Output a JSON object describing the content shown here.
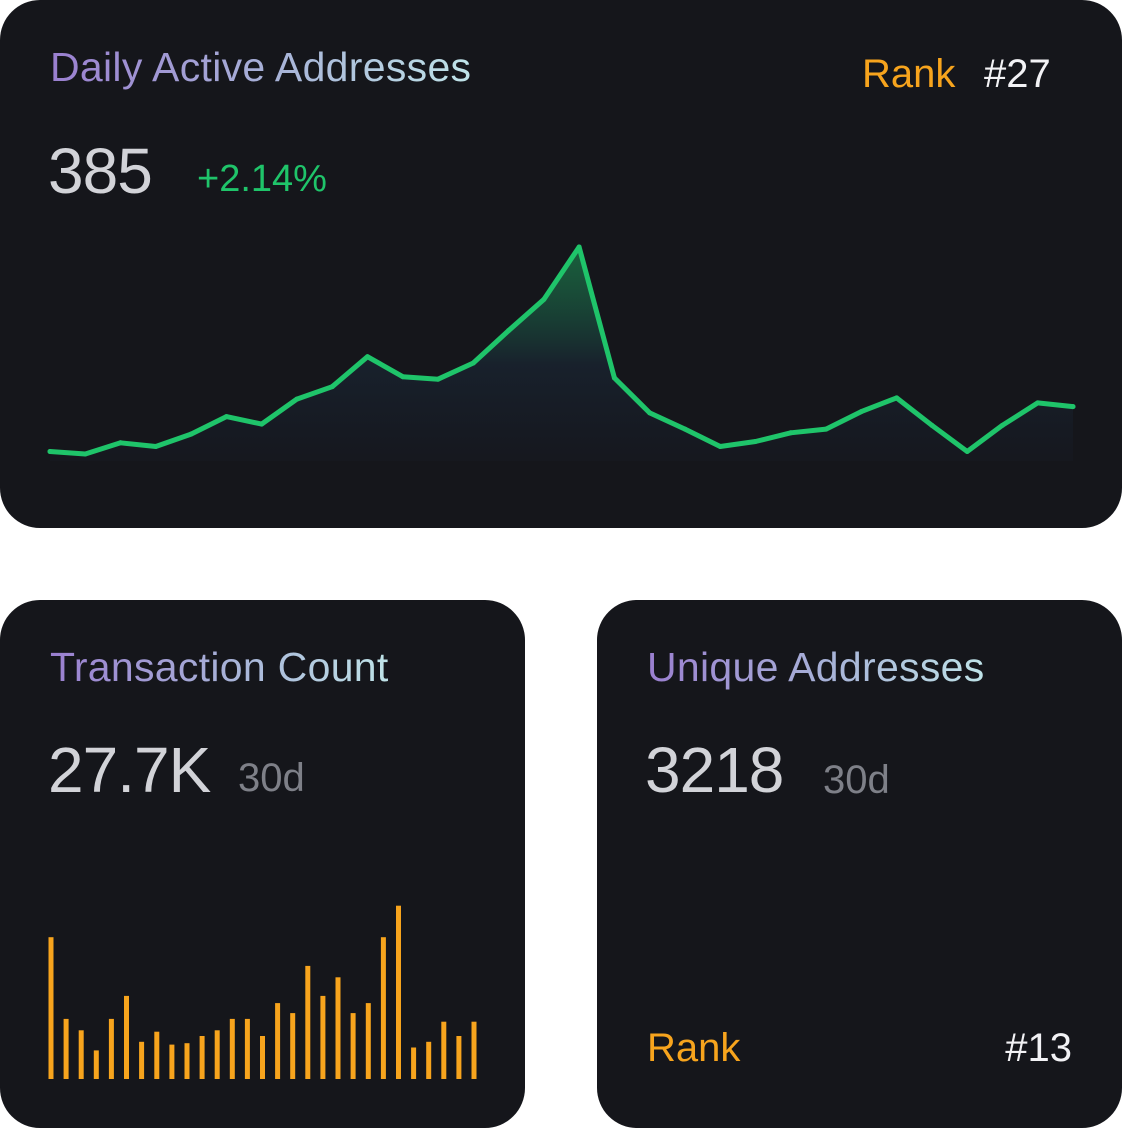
{
  "colors": {
    "card_bg": "#15161b",
    "accent_green": "#1fc46a",
    "accent_orange": "#f7a41d",
    "value_text": "#d2d3d8",
    "muted_text": "#7e8088"
  },
  "cards": {
    "daily_active": {
      "title": "Daily Active Addresses",
      "value": "385",
      "change": "+2.14%",
      "rank_label": "Rank",
      "rank_value": "#27"
    },
    "transactions": {
      "title": "Transaction Count",
      "value": "27.7K",
      "period": "30d"
    },
    "unique": {
      "title": "Unique Addresses",
      "value": "3218",
      "period": "30d",
      "rank_label": "Rank",
      "rank_value": "#13"
    }
  },
  "chart_data": [
    {
      "type": "area",
      "series": [
        {
          "values": [
            6,
            4,
            13,
            10,
            20,
            34,
            28,
            48,
            58,
            82,
            66,
            64,
            77,
            103,
            128,
            170,
            65,
            37,
            24,
            10,
            14,
            21,
            24,
            38,
            49,
            27,
            6,
            27,
            45,
            42
          ]
        }
      ],
      "ylim": [
        0,
        180
      ],
      "grid": false,
      "color": "#1fc46a"
    },
    {
      "type": "bar",
      "series": [
        {
          "values": [
            99,
            42,
            34,
            20,
            42,
            58,
            26,
            33,
            24,
            25,
            30,
            34,
            42,
            42,
            30,
            53,
            46,
            79,
            58,
            71,
            46,
            53,
            99,
            121,
            22,
            26,
            40,
            30,
            40
          ]
        }
      ],
      "ylim": [
        0,
        125
      ],
      "grid": false,
      "color": "#f7a41d"
    }
  ]
}
